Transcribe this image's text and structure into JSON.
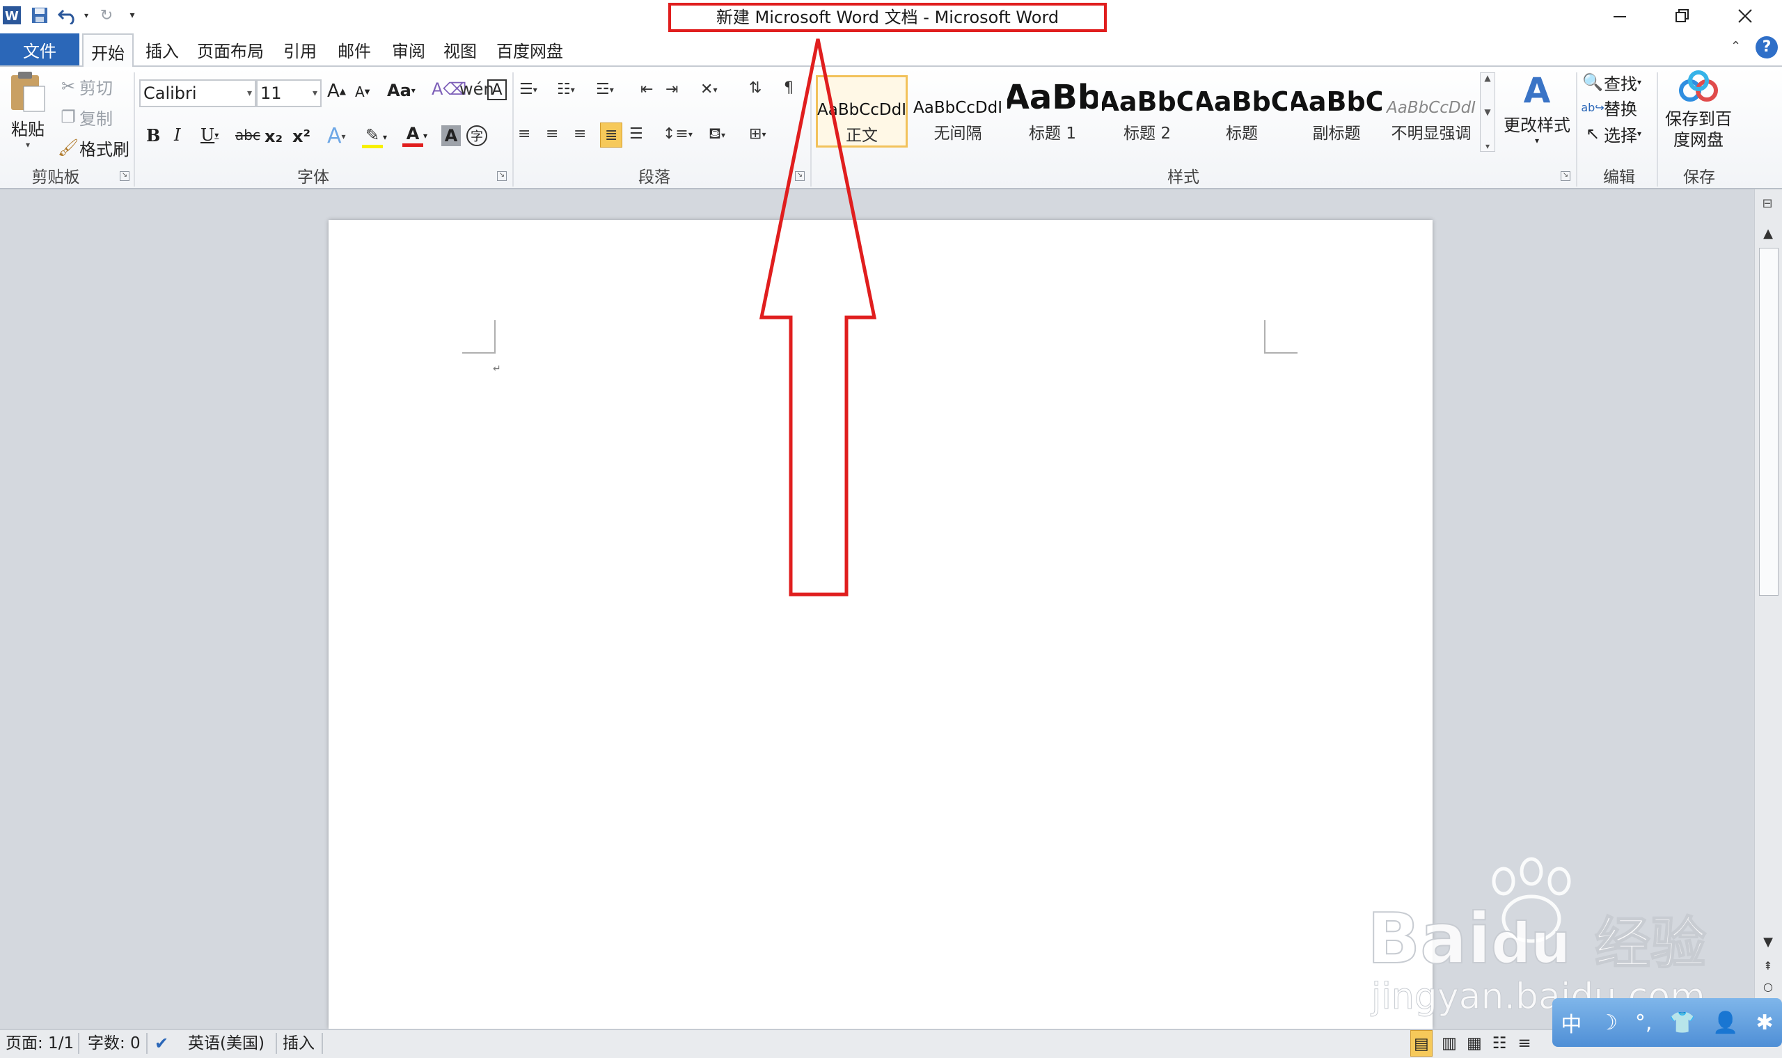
{
  "titlebar": {
    "title": "新建 Microsoft Word 文档 - Microsoft Word",
    "window_controls": [
      "minimize-icon",
      "restore-icon",
      "close-icon"
    ]
  },
  "qat": {
    "icons": [
      "word-logo-icon",
      "save-icon",
      "undo-icon",
      "redo-icon",
      "customize-qat-icon"
    ]
  },
  "tabs": {
    "file": "文件",
    "items": [
      "开始",
      "插入",
      "页面布局",
      "引用",
      "邮件",
      "审阅",
      "视图",
      "百度网盘"
    ],
    "active_index": 0
  },
  "ribbon": {
    "clipboard": {
      "label": "剪贴板",
      "paste": "粘贴",
      "cut": "剪切",
      "copy": "复制",
      "format_painter": "格式刷"
    },
    "font": {
      "label": "字体",
      "font_name": "Calibri",
      "font_size": "11",
      "bold": "B",
      "italic": "I",
      "underline": "U",
      "strikethrough": "abc",
      "subscript": "x₂",
      "superscript": "x²",
      "change_case": "Aa",
      "grow": "A",
      "shrink": "A"
    },
    "paragraph": {
      "label": "段落"
    },
    "styles": {
      "label": "样式",
      "items": [
        {
          "sample": "AaBbCcDdI",
          "name": "正文"
        },
        {
          "sample": "AaBbCcDdI",
          "name": "无间隔"
        },
        {
          "sample": "AaBb",
          "name": "标题 1"
        },
        {
          "sample": "AaBbC",
          "name": "标题 2"
        },
        {
          "sample": "AaBbC",
          "name": "标题"
        },
        {
          "sample": "AaBbC",
          "name": "副标题"
        },
        {
          "sample": "AaBbCcDdI",
          "name": "不明显强调"
        }
      ],
      "change_styles": "更改样式"
    },
    "editing": {
      "label": "编辑",
      "find": "查找",
      "replace": "替换",
      "select": "选择"
    },
    "save": {
      "label": "保存",
      "save_to_baidu": "保存到百度网盘"
    }
  },
  "statusbar": {
    "page": "页面: 1/1",
    "words": "字数: 0",
    "language": "英语(美国)",
    "mode": "插入"
  },
  "watermark": {
    "brand": "Bai",
    "brand2": "du",
    "jingyan": "经验",
    "url": "jingyan.baidu.com"
  },
  "ime": {
    "lang": "中"
  },
  "colors": {
    "file_tab": "#2b67b8",
    "annotation_red": "#e01e1e",
    "style_selected_border": "#f2c25b"
  }
}
